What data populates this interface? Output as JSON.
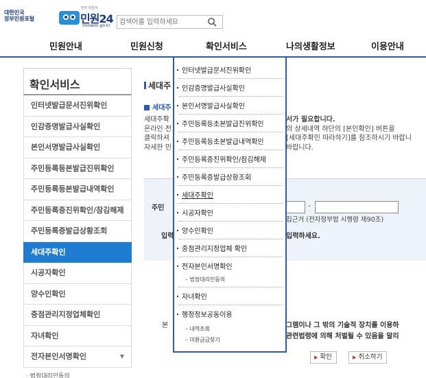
{
  "header": {
    "gov_logo": "대한민국\n정부민원포털",
    "logo_small": "전자 민원서",
    "logo_text": "민원24",
    "logo_url": "minwon.go.kr",
    "search_placeholder": "검색어를 입력하세요"
  },
  "nav": {
    "items": [
      "민원안내",
      "민원신청",
      "확인서비스",
      "나의생활정보",
      "이용안내"
    ]
  },
  "sidebar": {
    "title": "확인서비스",
    "items": [
      "인터넷발급문서진위확인",
      "인감증명발급사실확인",
      "본인서명발급사실확인",
      "주민등록등본발급진위확인",
      "주민등록등본발급내역확인",
      "주민등록증진위확인/잠김해제",
      "주민등록증발급상황조회",
      "세대주확인",
      "시공자확인",
      "양수인확인",
      "중점관리지정업체확인",
      "자녀확인",
      "전자본인서명확인"
    ],
    "sub_item": "· 법정대리인동의"
  },
  "main": {
    "title": "세대주",
    "section": "세대주",
    "desc_left": [
      "세대주확",
      "온라인 전",
      "클릭하셔",
      "자세한 민"
    ],
    "desc_right": [
      "서가 필요합니다.",
      "의 상세내역 하단의 [본인확인] 버튼을",
      "[세대주확인 따라하기]를 참조하시기 바랍니",
      "바랍니다."
    ],
    "form_label1": "주민",
    "form_label2": "입력",
    "law_ref": "집근거 (전자정부법 시행령 제90조)",
    "enter_msg": "입력하세요.",
    "warn_head": "본",
    "warn1": "그램이나 그 밖의 기술적 장치를 이용하",
    "warn2": "관련법령에 의해 처벌될 수 있음을 알리",
    "confirm_btn": "확인",
    "cancel_btn": "취소하기"
  },
  "dropdown": {
    "items": [
      "인터넷발급문서진위확인",
      "인감증명발급사실확인",
      "본인서명발급사실확인",
      "주민등록등초본발급진위확인",
      "주민등록등초본발급내역확인",
      "주민등록증진위확인/잠김해제",
      "주민등록증발급상황조회",
      "세대주확인",
      "시공자확인",
      "양수인확인",
      "중점관리지정업체 확인",
      "전자본인서명확인",
      "자녀확인",
      "행정정보공동이용"
    ],
    "sub_legal": "– 법정대리인동의",
    "sub_history": "– 내역조회",
    "sub_unclaimed": "– 미환급금찾기"
  },
  "colors": {
    "accent": "#2b5aa8",
    "active": "#1f7dd1"
  }
}
